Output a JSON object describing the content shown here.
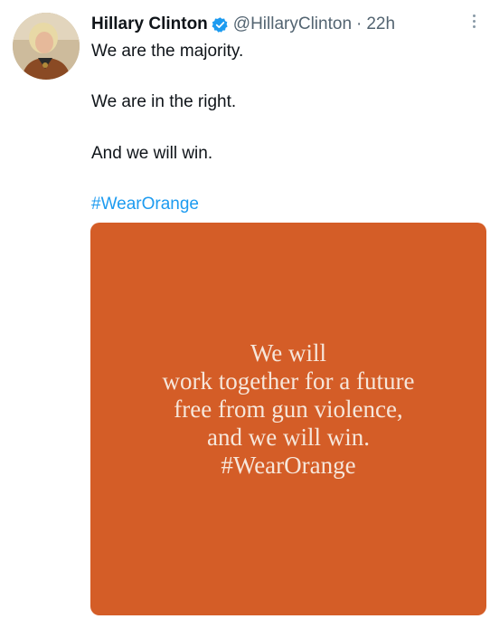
{
  "author": {
    "display_name": "Hillary Clinton",
    "handle": "@HillaryClinton",
    "separator": "·",
    "time": "22h",
    "verified": true
  },
  "icons": {
    "avatar": "profile-photo",
    "verified": "verified-badge-icon",
    "more": "more-options-icon"
  },
  "tweet": {
    "lines": [
      "We are the majority.",
      "We are in the right.",
      "And we will win."
    ],
    "hashtag": "#WearOrange"
  },
  "media": {
    "background_color": "#d45d27",
    "text_lines": [
      "We will",
      "work together for a future",
      "free from gun violence,",
      "and we will win.",
      "#WearOrange"
    ]
  },
  "colors": {
    "link": "#1d9bf0",
    "verified": "#1d9bf0",
    "muted": "#536471"
  }
}
